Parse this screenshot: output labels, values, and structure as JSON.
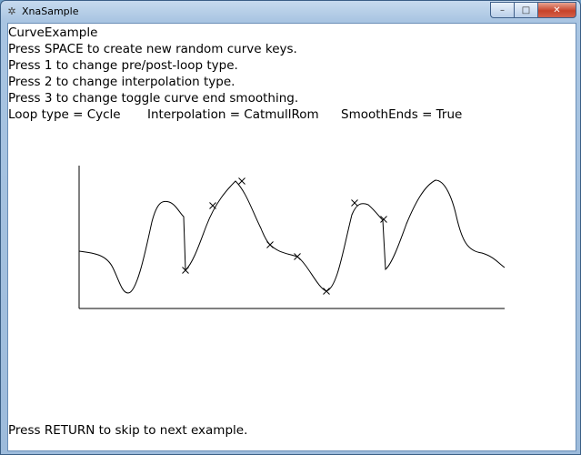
{
  "window": {
    "title": "XnaSample",
    "app_icon": "xna-icon",
    "controls": {
      "minimize": "–",
      "maximize": "□",
      "close": "✕"
    }
  },
  "content": {
    "heading": "CurveExample",
    "instructions": [
      "Press SPACE to create new random curve keys.",
      "Press 1 to change pre/post-loop type.",
      "Press 2 to change interpolation type.",
      "Press 3 to change toggle curve end smoothing."
    ],
    "status": {
      "loop_type": "Loop type = Cycle",
      "interpolation": "Interpolation = CatmullRom",
      "smooth_ends": "SmoothEnds = True"
    },
    "footer": "Press RETURN to skip to next example."
  },
  "curve": {
    "stroke": "#000000",
    "keys": [
      {
        "t": 0.0,
        "v": 0.45
      },
      {
        "t": 0.1,
        "v": 0.9
      },
      {
        "t": 0.2,
        "v": 0.18
      },
      {
        "t": 0.3,
        "v": 0.4
      },
      {
        "t": 0.4,
        "v": 0.7
      },
      {
        "t": 0.5,
        "v": 0.6
      },
      {
        "t": 0.6,
        "v": 0.95
      }
    ]
  }
}
